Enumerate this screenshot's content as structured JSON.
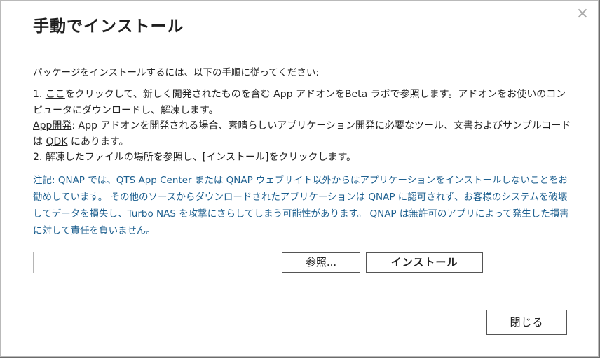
{
  "dialog": {
    "title": "手動でインストール",
    "close_glyph": "×",
    "intro": "パッケージをインストールするには、以下の手順に従ってください:",
    "step1": {
      "prefix": "1. ",
      "link": "ここ",
      "text": "をクリックして、新しく開発されたものを含む App アドオンをBeta ラボで参照します。アドオンをお使いのコンピュータにダウンロードし、解凍します。"
    },
    "app_dev": {
      "link": "App開発",
      "text_before_qdk": ": App アドオンを開発される場合、素晴らしいアプリケーション開発に必要なツール、文書およびサンプルコードは ",
      "qdk_link": "QDK",
      "text_after_qdk": " にあります。"
    },
    "step2": "2. 解凍したファイルの場所を参照し、[インストール]をクリックします。",
    "note": "注記: QNAP では、QTS App Center または QNAP ウェブサイト以外からはアプリケーションをインストールしないことをお勧めしています。 その他のソースからダウンロードされたアプリケーションは QNAP に認可されず、お客様のシステムを破壊してデータを損失し、Turbo NAS を攻撃にさらしてしまう可能性があります。 QNAP は無許可のアプリによって発生した損害に対して責任を負いません。",
    "file_value": "",
    "browse_label": "参照...",
    "install_label": "インストール",
    "close_label": "閉じる"
  },
  "colors": {
    "note_text": "#1c5f8f",
    "background_overlay": "#6b6b6b"
  }
}
